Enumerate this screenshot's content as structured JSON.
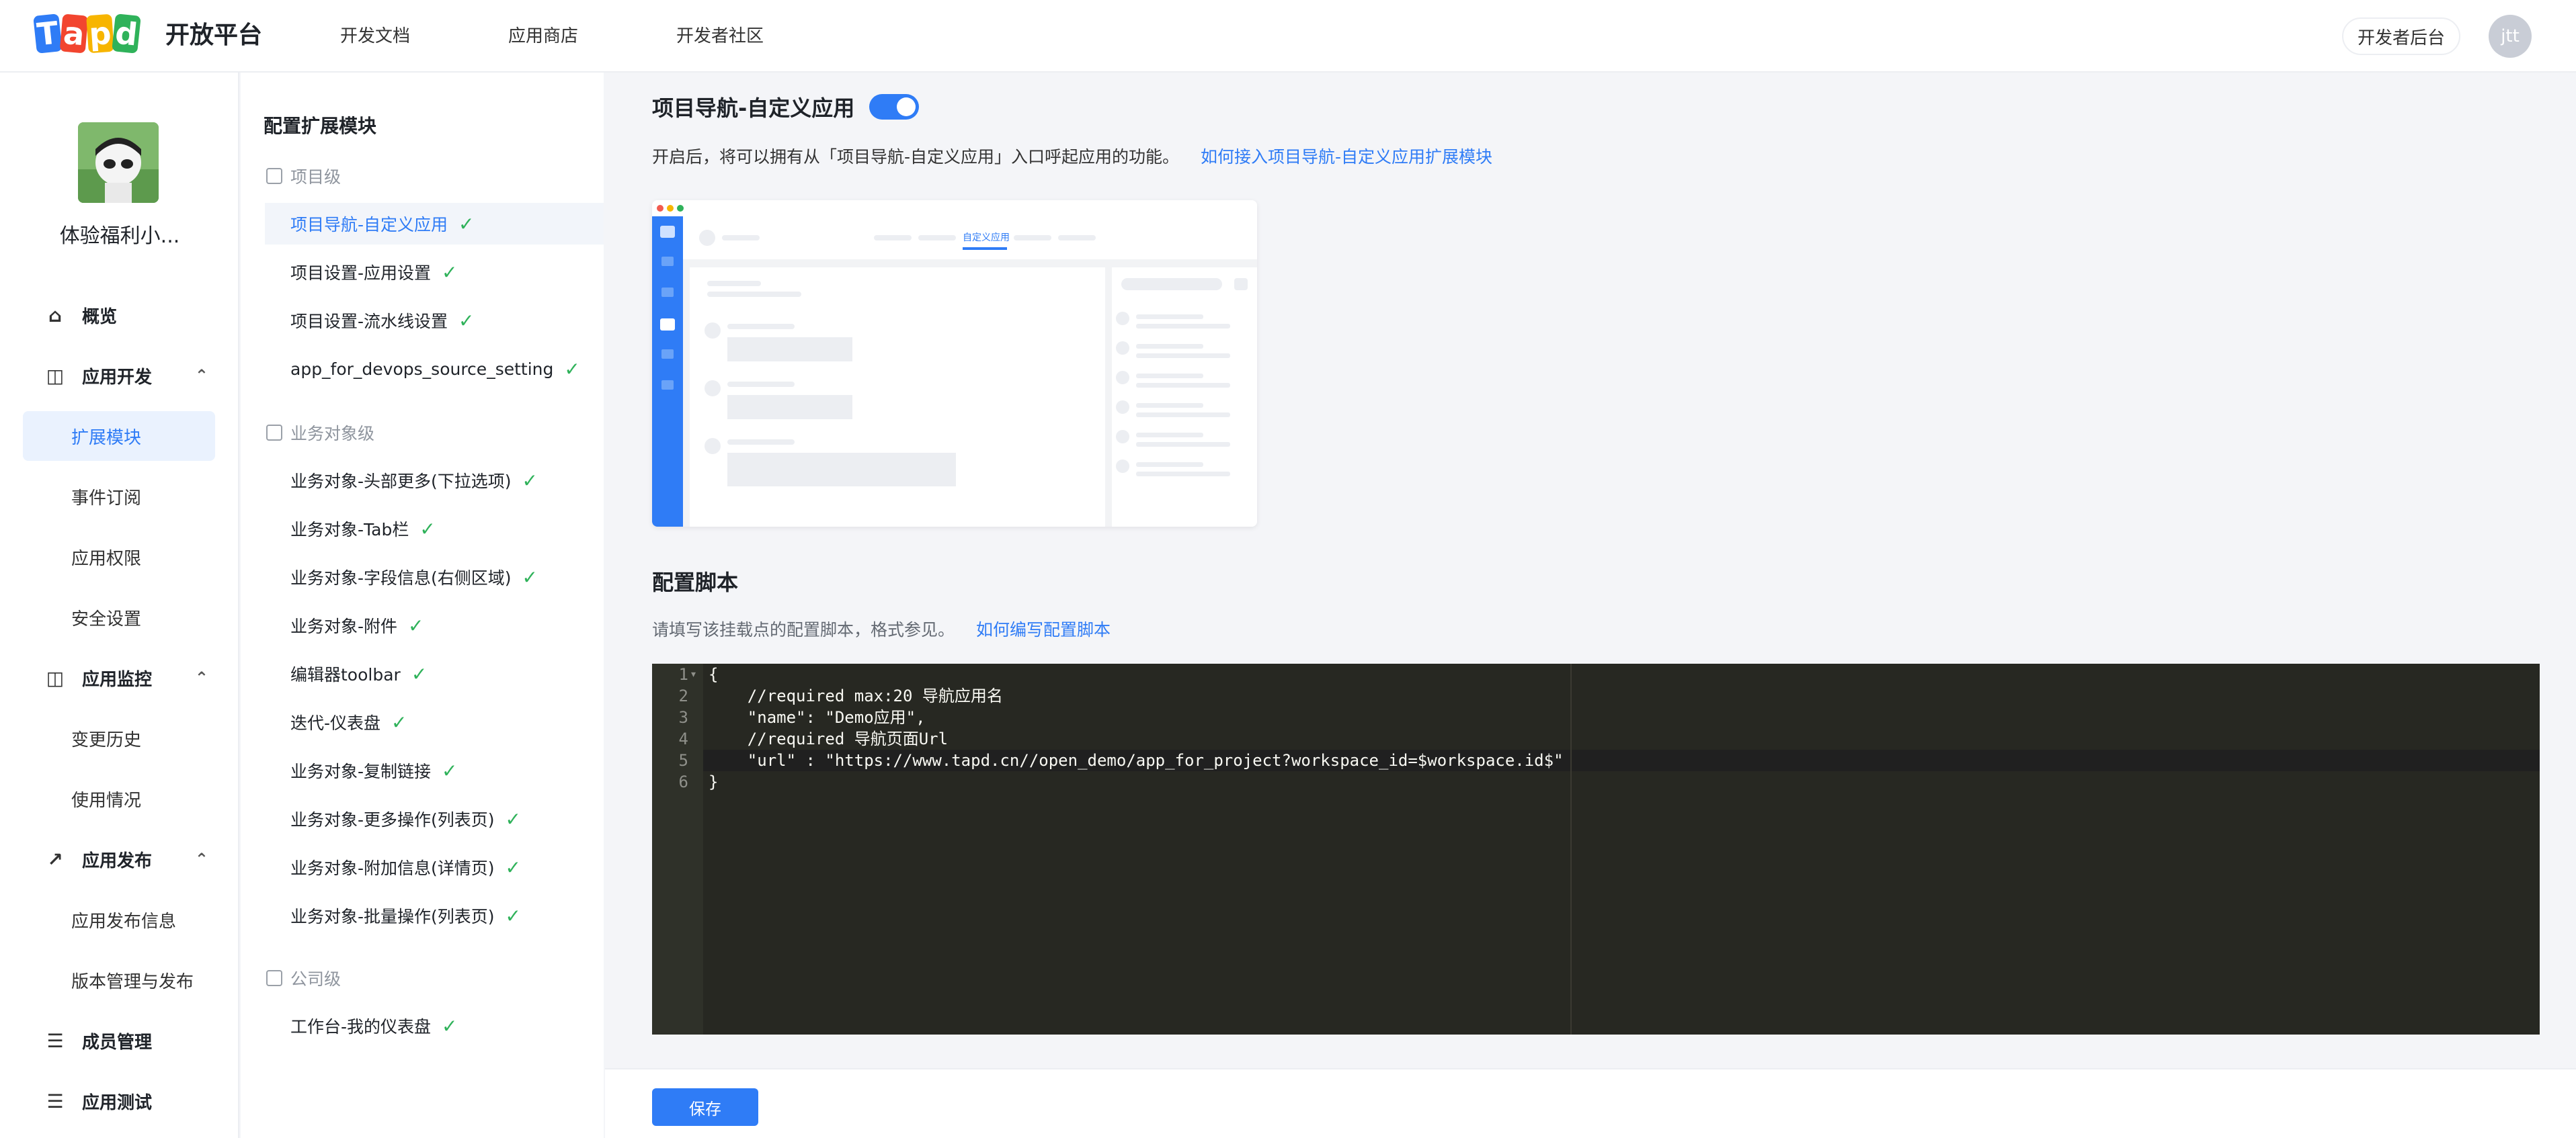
{
  "topbar": {
    "logo_letters": [
      "T",
      "a",
      "p",
      "d"
    ],
    "logo_colors": [
      "#2f7cf6",
      "#f2452f",
      "#f7b500",
      "#2fb25a"
    ],
    "platform_title": "开放平台",
    "links": [
      "开发文档",
      "应用商店",
      "开发者社区"
    ],
    "dev_console": "开发者后台",
    "user_initials": "jtt"
  },
  "sidebar": {
    "app_name": "体验福利小...",
    "overview": "概览",
    "groups": {
      "dev": "应用开发",
      "monitor": "应用监控",
      "publish": "应用发布",
      "members": "成员管理",
      "test": "应用测试"
    },
    "dev_items": [
      "扩展模块",
      "事件订阅",
      "应用权限",
      "安全设置"
    ],
    "monitor_items": [
      "变更历史",
      "使用情况"
    ],
    "publish_items": [
      "应用发布信息",
      "版本管理与发布"
    ]
  },
  "modules": {
    "title": "配置扩展模块",
    "project_group": "项目级",
    "project_items": [
      "项目导航-自定义应用",
      "项目设置-应用设置",
      "项目设置-流水线设置",
      "app_for_devops_source_setting"
    ],
    "object_group": "业务对象级",
    "object_items": [
      "业务对象-头部更多(下拉选项)",
      "业务对象-Tab栏",
      "业务对象-字段信息(右侧区域)",
      "业务对象-附件",
      "编辑器toolbar",
      "迭代-仪表盘",
      "业务对象-复制链接",
      "业务对象-更多操作(列表页)",
      "业务对象-附加信息(详情页)",
      "业务对象-批量操作(列表页)"
    ],
    "company_group": "公司级",
    "company_items": [
      "工作台-我的仪表盘"
    ]
  },
  "main": {
    "section_title": "项目导航-自定义应用",
    "toggle_on": true,
    "description": "开启后，将可以拥有从「项目导航-自定义应用」入口呼起应用的功能。",
    "description_link": "如何接入项目导航-自定义应用扩展模块",
    "preview_tab_label": "自定义应用",
    "config_title": "配置脚本",
    "config_desc": "请填写该挂载点的配置脚本，格式参见。",
    "config_link": "如何编写配置脚本",
    "code_lines": [
      "{",
      "    //required max:20 导航应用名",
      "    \"name\": \"Demo应用\",",
      "    //required 导航页面Url",
      "    \"url\" : \"https://www.tapd.cn//open_demo/app_for_project?workspace_id=$workspace.id$\"",
      "}"
    ],
    "line_numbers": [
      "1",
      "2",
      "3",
      "4",
      "5",
      "6"
    ],
    "save_label": "保存"
  },
  "colors": {
    "accent": "#2f7cf6",
    "check": "#2fb25a",
    "editor_bg": "#272822"
  }
}
